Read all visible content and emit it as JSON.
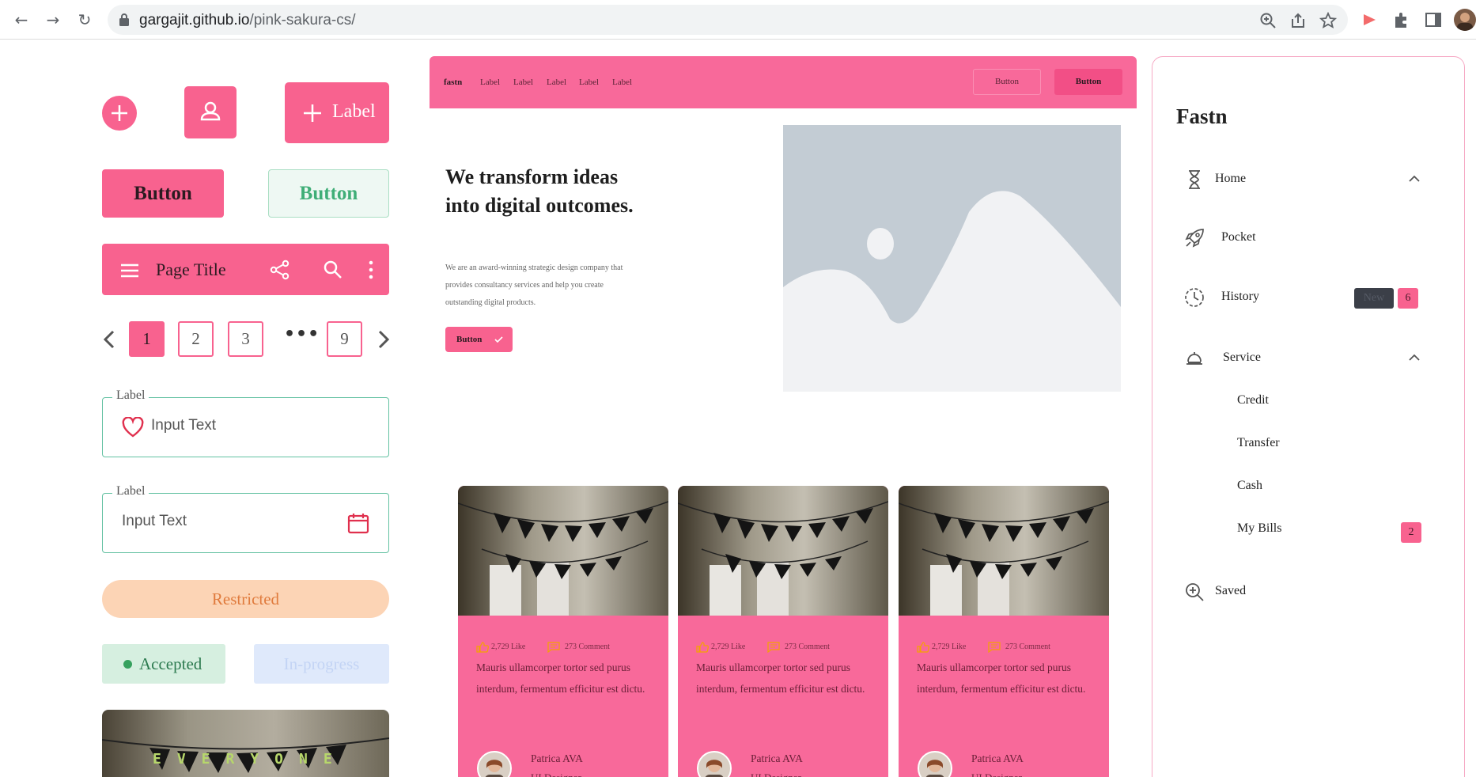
{
  "browser": {
    "url_host": "gargajit.github.io",
    "url_path": "/pink-sakura-cs/"
  },
  "colors": {
    "primary_pink": "#f8628f",
    "nav_pink": "#f8699a",
    "mint": "#63c1a2",
    "restricted_bg": "#fcd4b5",
    "accepted_bg": "#d6efe0",
    "inprogress_bg": "#dfe9fb"
  },
  "left": {
    "fab_label": "Label",
    "button_primary": "Button",
    "button_secondary": "Button",
    "app_bar_title": "Page Title",
    "pagination": {
      "pages": [
        "1",
        "2",
        "3",
        "9"
      ],
      "active": "1",
      "ellipsis": "•••"
    },
    "field_icon_left": {
      "label": "Label",
      "placeholder": "Input Text"
    },
    "field_icon_right": {
      "label": "Label",
      "placeholder": "Input Text"
    },
    "status_restricted": "Restricted",
    "status_accepted": "Accepted",
    "status_inprogress": "In-progress",
    "banner_text": "EVERYONE"
  },
  "hero": {
    "nav": {
      "brand": "fastn",
      "links": [
        "Label",
        "Label",
        "Label",
        "Label",
        "Label"
      ],
      "button_outline": "Button",
      "button_filled": "Button"
    },
    "title": "We transform ideas into digital outcomes.",
    "description": "We are an award-winning strategic design company that provides consultancy services and help you create outstanding digital products.",
    "cta": "Button"
  },
  "cards": [
    {
      "likes": "2,729 Like",
      "comments": "273 Comment",
      "body": "Mauris ullamcorper tortor sed purus interdum, fermentum efficitur est dictu.",
      "author": "Patrica AVA",
      "role": "UI Designer"
    },
    {
      "likes": "2,729 Like",
      "comments": "273 Comment",
      "body": "Mauris ullamcorper tortor sed purus interdum, fermentum efficitur est dictu.",
      "author": "Patrica AVA",
      "role": "UI Designer"
    },
    {
      "likes": "2,729 Like",
      "comments": "273 Comment",
      "body": "Mauris ullamcorper tortor sed purus interdum, fermentum efficitur est dictu.",
      "author": "Patrica AVA",
      "role": "UI Designer"
    }
  ],
  "sidebar": {
    "logo": "Fastn",
    "items": [
      {
        "label": "Home",
        "icon": "hourglass-icon",
        "expanded": true
      },
      {
        "label": "Pocket",
        "icon": "rocket-icon"
      },
      {
        "label": "History",
        "icon": "clock-icon",
        "badge_new": "New",
        "badge_count": "6"
      },
      {
        "label": "Service",
        "icon": "bell-icon",
        "expanded": true
      },
      {
        "label": "Saved",
        "icon": "zoom-in-icon"
      }
    ],
    "sub_items": [
      {
        "label": "Credit"
      },
      {
        "label": "Transfer"
      },
      {
        "label": "Cash"
      },
      {
        "label": "My Bills",
        "badge_count": "2"
      }
    ]
  }
}
